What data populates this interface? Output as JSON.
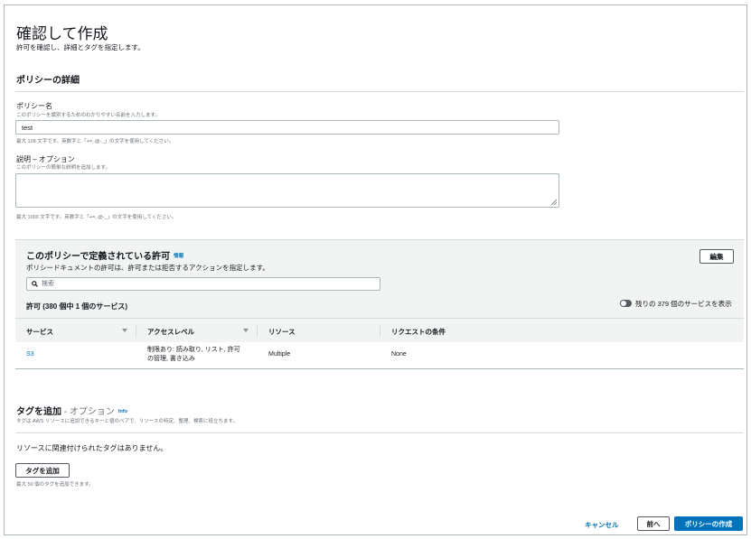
{
  "page": {
    "title": "確認して作成",
    "subtitle": "許可を確認し、詳細とタグを指定します。"
  },
  "details": {
    "section_title": "ポリシーの詳細",
    "name": {
      "label": "ポリシー名",
      "description": "このポリシーを識別するためのわかりやすい名前を入力します。",
      "value": "test",
      "hint": "最大 128 文字です。英数字と「+=,.@-_」の文字を使用してください。"
    },
    "description_field": {
      "label": "説明 – オプション",
      "description": "このポリシーの簡単な説明を追加します。",
      "value": "",
      "hint": "最大 1000 文字です。英数字と「+=,.@-_」の文字を使用してください。"
    }
  },
  "permissions": {
    "title": "このポリシーで定義されている許可",
    "info_link": "情報",
    "subtitle": "ポリシードキュメントの許可は、許可または拒否するアクションを指定します。",
    "edit_button": "編集",
    "search_placeholder": "検索",
    "count_label": "許可 (380 個中 1 個のサービス)",
    "toggle_label": "残りの 379 個のサービスを表示",
    "columns": [
      "サービス",
      "アクセスレベル",
      "リソース",
      "リクエストの条件"
    ],
    "rows": [
      {
        "service": "S3",
        "access_level_line1": "制限あり: 読み取り, リスト, 許可",
        "access_level_line2": "の管理, 書き込み",
        "resource": "Multiple",
        "condition": "None"
      }
    ]
  },
  "tags": {
    "title": "タグを追加",
    "optional": " - オプション",
    "info_link": "Info",
    "description": "タグは AWS リソースに追加できるキーと値のペアで、リソースの特定、整理、検索に役立ちます。",
    "empty_text": "リソースに関連付けられたタグはありません。",
    "add_button": "タグを追加",
    "hint": "最大 50 個のタグを追加できます。"
  },
  "footer": {
    "cancel": "キャンセル",
    "previous": "前へ",
    "create": "ポリシーの作成"
  },
  "colors": {
    "link": "#0073bb",
    "primary": "#0073bb",
    "panel_bg": "#f2f3f3",
    "border": "#d5dbdb"
  }
}
